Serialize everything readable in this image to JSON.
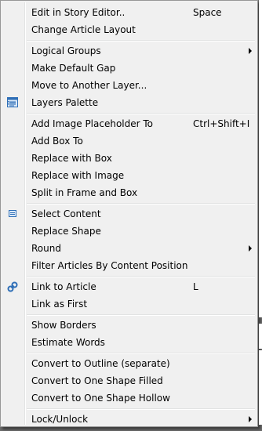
{
  "menu": {
    "items": [
      {
        "label": "Edit in Story Editor..",
        "shortcut": "Space"
      },
      {
        "label": "Change Article Layout"
      },
      {
        "label": "Logical Groups",
        "submenu": true
      },
      {
        "label": "Make Default Gap"
      },
      {
        "label": "Move to Another Layer..."
      },
      {
        "label": "Layers Palette",
        "icon": "layers-palette-icon"
      },
      {
        "label": "Add Image Placeholder To",
        "shortcut": "Ctrl+Shift+I"
      },
      {
        "label": "Add Box To"
      },
      {
        "label": "Replace with Box"
      },
      {
        "label": "Replace with Image"
      },
      {
        "label": "Split in Frame and Box"
      },
      {
        "label": "Select Content",
        "icon": "select-content-icon"
      },
      {
        "label": "Replace Shape"
      },
      {
        "label": "Round",
        "submenu": true
      },
      {
        "label": "Filter Articles By Content Position"
      },
      {
        "label": "Link to Article",
        "shortcut": "L",
        "icon": "link-icon"
      },
      {
        "label": "Link as First"
      },
      {
        "label": "Show Borders"
      },
      {
        "label": "Estimate Words"
      },
      {
        "label": "Convert to Outline (separate)"
      },
      {
        "label": "Convert to One Shape Filled"
      },
      {
        "label": "Convert to One Shape Hollow"
      },
      {
        "label": "Lock/Unlock",
        "submenu": true
      }
    ]
  },
  "colors": {
    "menu_background": "#f0f0f0",
    "icon_blue": "#2f6fb7"
  }
}
